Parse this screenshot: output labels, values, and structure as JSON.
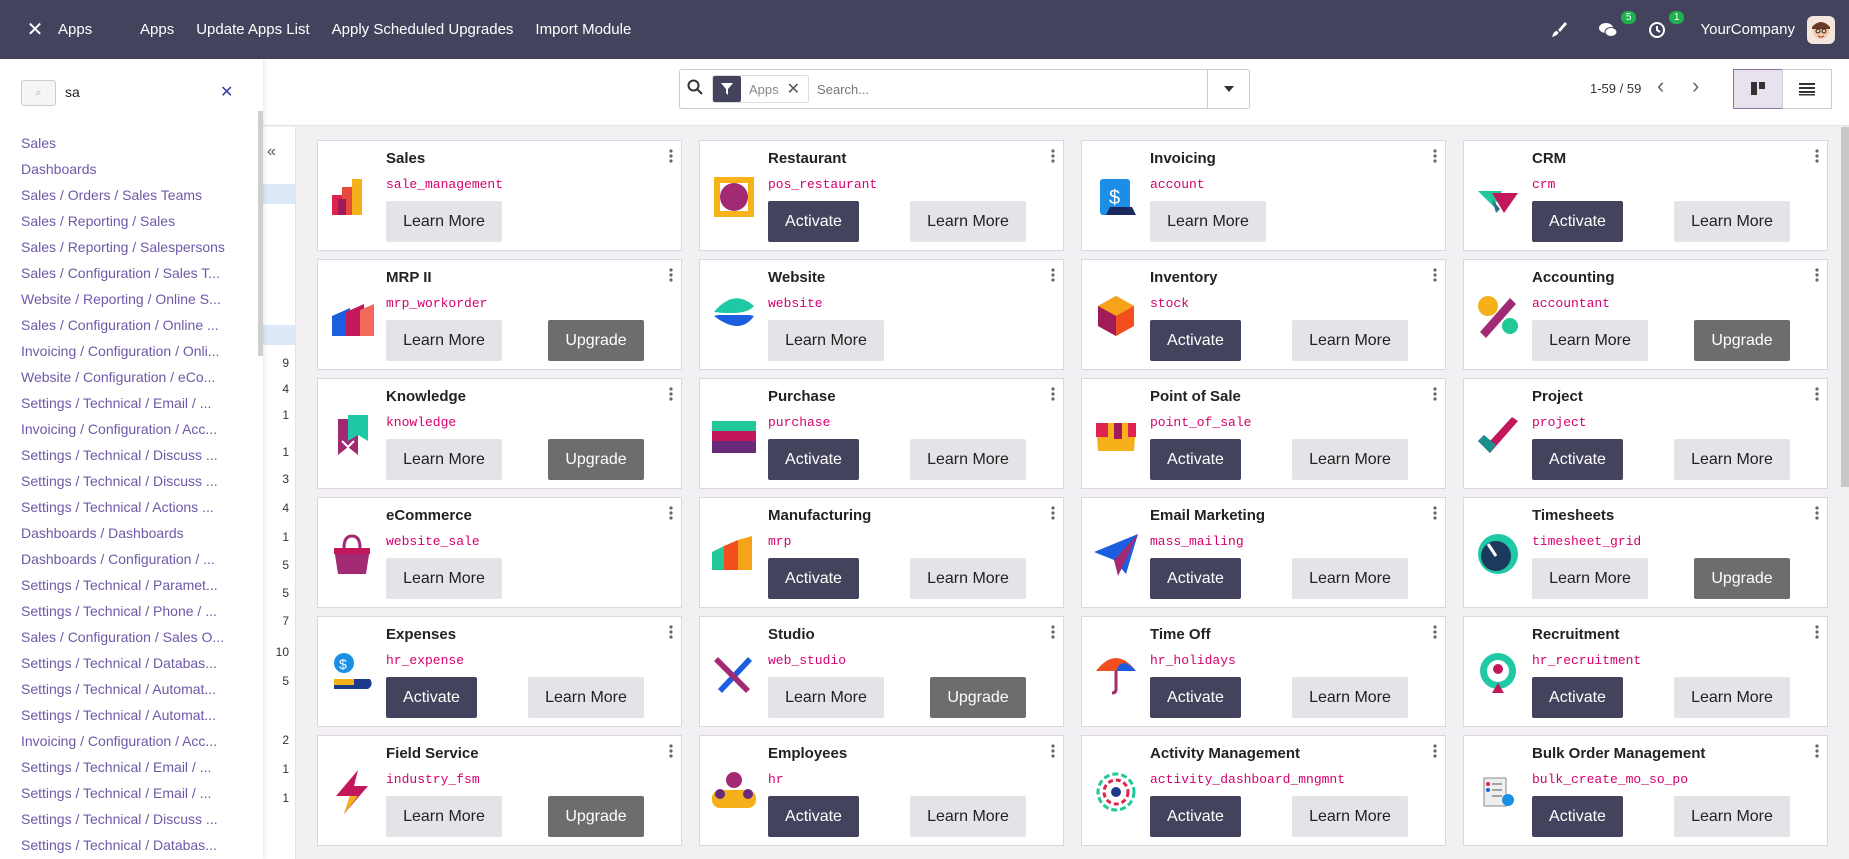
{
  "topbar": {
    "brand": "Apps",
    "menu": [
      "Apps",
      "Update Apps List",
      "Apply Scheduled Upgrades",
      "Import Module"
    ],
    "messages_badge": "5",
    "activities_badge": "1",
    "company": "YourCompany"
  },
  "search": {
    "facet_label": "Apps",
    "placeholder": "Search..."
  },
  "pager": {
    "text": "1-59 / 59"
  },
  "left_panel": {
    "query": "sa",
    "items": [
      "Sales",
      "Dashboards",
      "Sales / Orders / Sales Teams",
      "Sales / Reporting / Sales",
      "Sales / Reporting / Salespersons",
      "Sales / Configuration / Sales T...",
      "Website / Reporting / Online S...",
      "Sales / Configuration / Online ...",
      "Invoicing / Configuration / Onli...",
      "Website / Configuration / eCo...",
      "Settings / Technical / Email / ...",
      "Invoicing / Configuration / Acc...",
      "Settings / Technical / Discuss ...",
      "Settings / Technical / Discuss ...",
      "Settings / Technical / Actions ...",
      "Dashboards / Dashboards",
      "Dashboards / Configuration / ...",
      "Settings / Technical / Paramet...",
      "Settings / Technical / Phone / ...",
      "Sales / Configuration / Sales O...",
      "Settings / Technical / Databas...",
      "Settings / Technical / Automat...",
      "Settings / Technical / Automat...",
      "Invoicing / Configuration / Acc...",
      "Settings / Technical / Email / ...",
      "Settings / Technical / Email / ...",
      "Settings / Technical / Discuss ...",
      "Settings / Technical / Databas..."
    ]
  },
  "behind_numbers": [
    "9",
    "4",
    "1",
    "1",
    "3",
    "4",
    "1",
    "5",
    "5",
    "7",
    "10",
    "5",
    "2",
    "1",
    "1"
  ],
  "apps": [
    {
      "name": "Sales",
      "tech": "sale_management",
      "buttons": [
        "Learn More"
      ],
      "icon": "sales-icon"
    },
    {
      "name": "Restaurant",
      "tech": "pos_restaurant",
      "buttons": [
        "Activate",
        "Learn More"
      ],
      "icon": "restaurant-icon"
    },
    {
      "name": "Invoicing",
      "tech": "account",
      "buttons": [
        "Learn More"
      ],
      "icon": "invoicing-icon"
    },
    {
      "name": "CRM",
      "tech": "crm",
      "buttons": [
        "Activate",
        "Learn More"
      ],
      "icon": "crm-icon"
    },
    {
      "name": "MRP II",
      "tech": "mrp_workorder",
      "buttons": [
        "Learn More",
        "Upgrade"
      ],
      "icon": "mrp-icon"
    },
    {
      "name": "Website",
      "tech": "website",
      "buttons": [
        "Learn More"
      ],
      "icon": "website-icon"
    },
    {
      "name": "Inventory",
      "tech": "stock",
      "buttons": [
        "Activate",
        "Learn More"
      ],
      "icon": "inventory-icon"
    },
    {
      "name": "Accounting",
      "tech": "accountant",
      "buttons": [
        "Learn More",
        "Upgrade"
      ],
      "icon": "accounting-icon"
    },
    {
      "name": "Knowledge",
      "tech": "knowledge",
      "buttons": [
        "Learn More",
        "Upgrade"
      ],
      "icon": "knowledge-icon"
    },
    {
      "name": "Purchase",
      "tech": "purchase",
      "buttons": [
        "Activate",
        "Learn More"
      ],
      "icon": "purchase-icon"
    },
    {
      "name": "Point of Sale",
      "tech": "point_of_sale",
      "buttons": [
        "Activate",
        "Learn More"
      ],
      "icon": "pos-icon"
    },
    {
      "name": "Project",
      "tech": "project",
      "buttons": [
        "Activate",
        "Learn More"
      ],
      "icon": "project-icon"
    },
    {
      "name": "eCommerce",
      "tech": "website_sale",
      "buttons": [
        "Learn More"
      ],
      "icon": "ecommerce-icon"
    },
    {
      "name": "Manufacturing",
      "tech": "mrp",
      "buttons": [
        "Activate",
        "Learn More"
      ],
      "icon": "manufacturing-icon"
    },
    {
      "name": "Email Marketing",
      "tech": "mass_mailing",
      "buttons": [
        "Activate",
        "Learn More"
      ],
      "icon": "email-marketing-icon"
    },
    {
      "name": "Timesheets",
      "tech": "timesheet_grid",
      "buttons": [
        "Learn More",
        "Upgrade"
      ],
      "icon": "timesheets-icon"
    },
    {
      "name": "Expenses",
      "tech": "hr_expense",
      "buttons": [
        "Activate",
        "Learn More"
      ],
      "icon": "expenses-icon"
    },
    {
      "name": "Studio",
      "tech": "web_studio",
      "buttons": [
        "Learn More",
        "Upgrade"
      ],
      "icon": "studio-icon"
    },
    {
      "name": "Time Off",
      "tech": "hr_holidays",
      "buttons": [
        "Activate",
        "Learn More"
      ],
      "icon": "timeoff-icon"
    },
    {
      "name": "Recruitment",
      "tech": "hr_recruitment",
      "buttons": [
        "Activate",
        "Learn More"
      ],
      "icon": "recruitment-icon"
    },
    {
      "name": "Field Service",
      "tech": "industry_fsm",
      "buttons": [
        "Learn More",
        "Upgrade"
      ],
      "icon": "field-service-icon"
    },
    {
      "name": "Employees",
      "tech": "hr",
      "buttons": [
        "Activate",
        "Learn More"
      ],
      "icon": "employees-icon"
    },
    {
      "name": "Activity Management",
      "tech": "activity_dashboard_mngmnt",
      "buttons": [
        "Activate",
        "Learn More"
      ],
      "icon": "activity-icon"
    },
    {
      "name": "Bulk Order Management",
      "tech": "bulk_create_mo_so_po",
      "buttons": [
        "Activate",
        "Learn More"
      ],
      "icon": "bulk-order-icon"
    }
  ]
}
